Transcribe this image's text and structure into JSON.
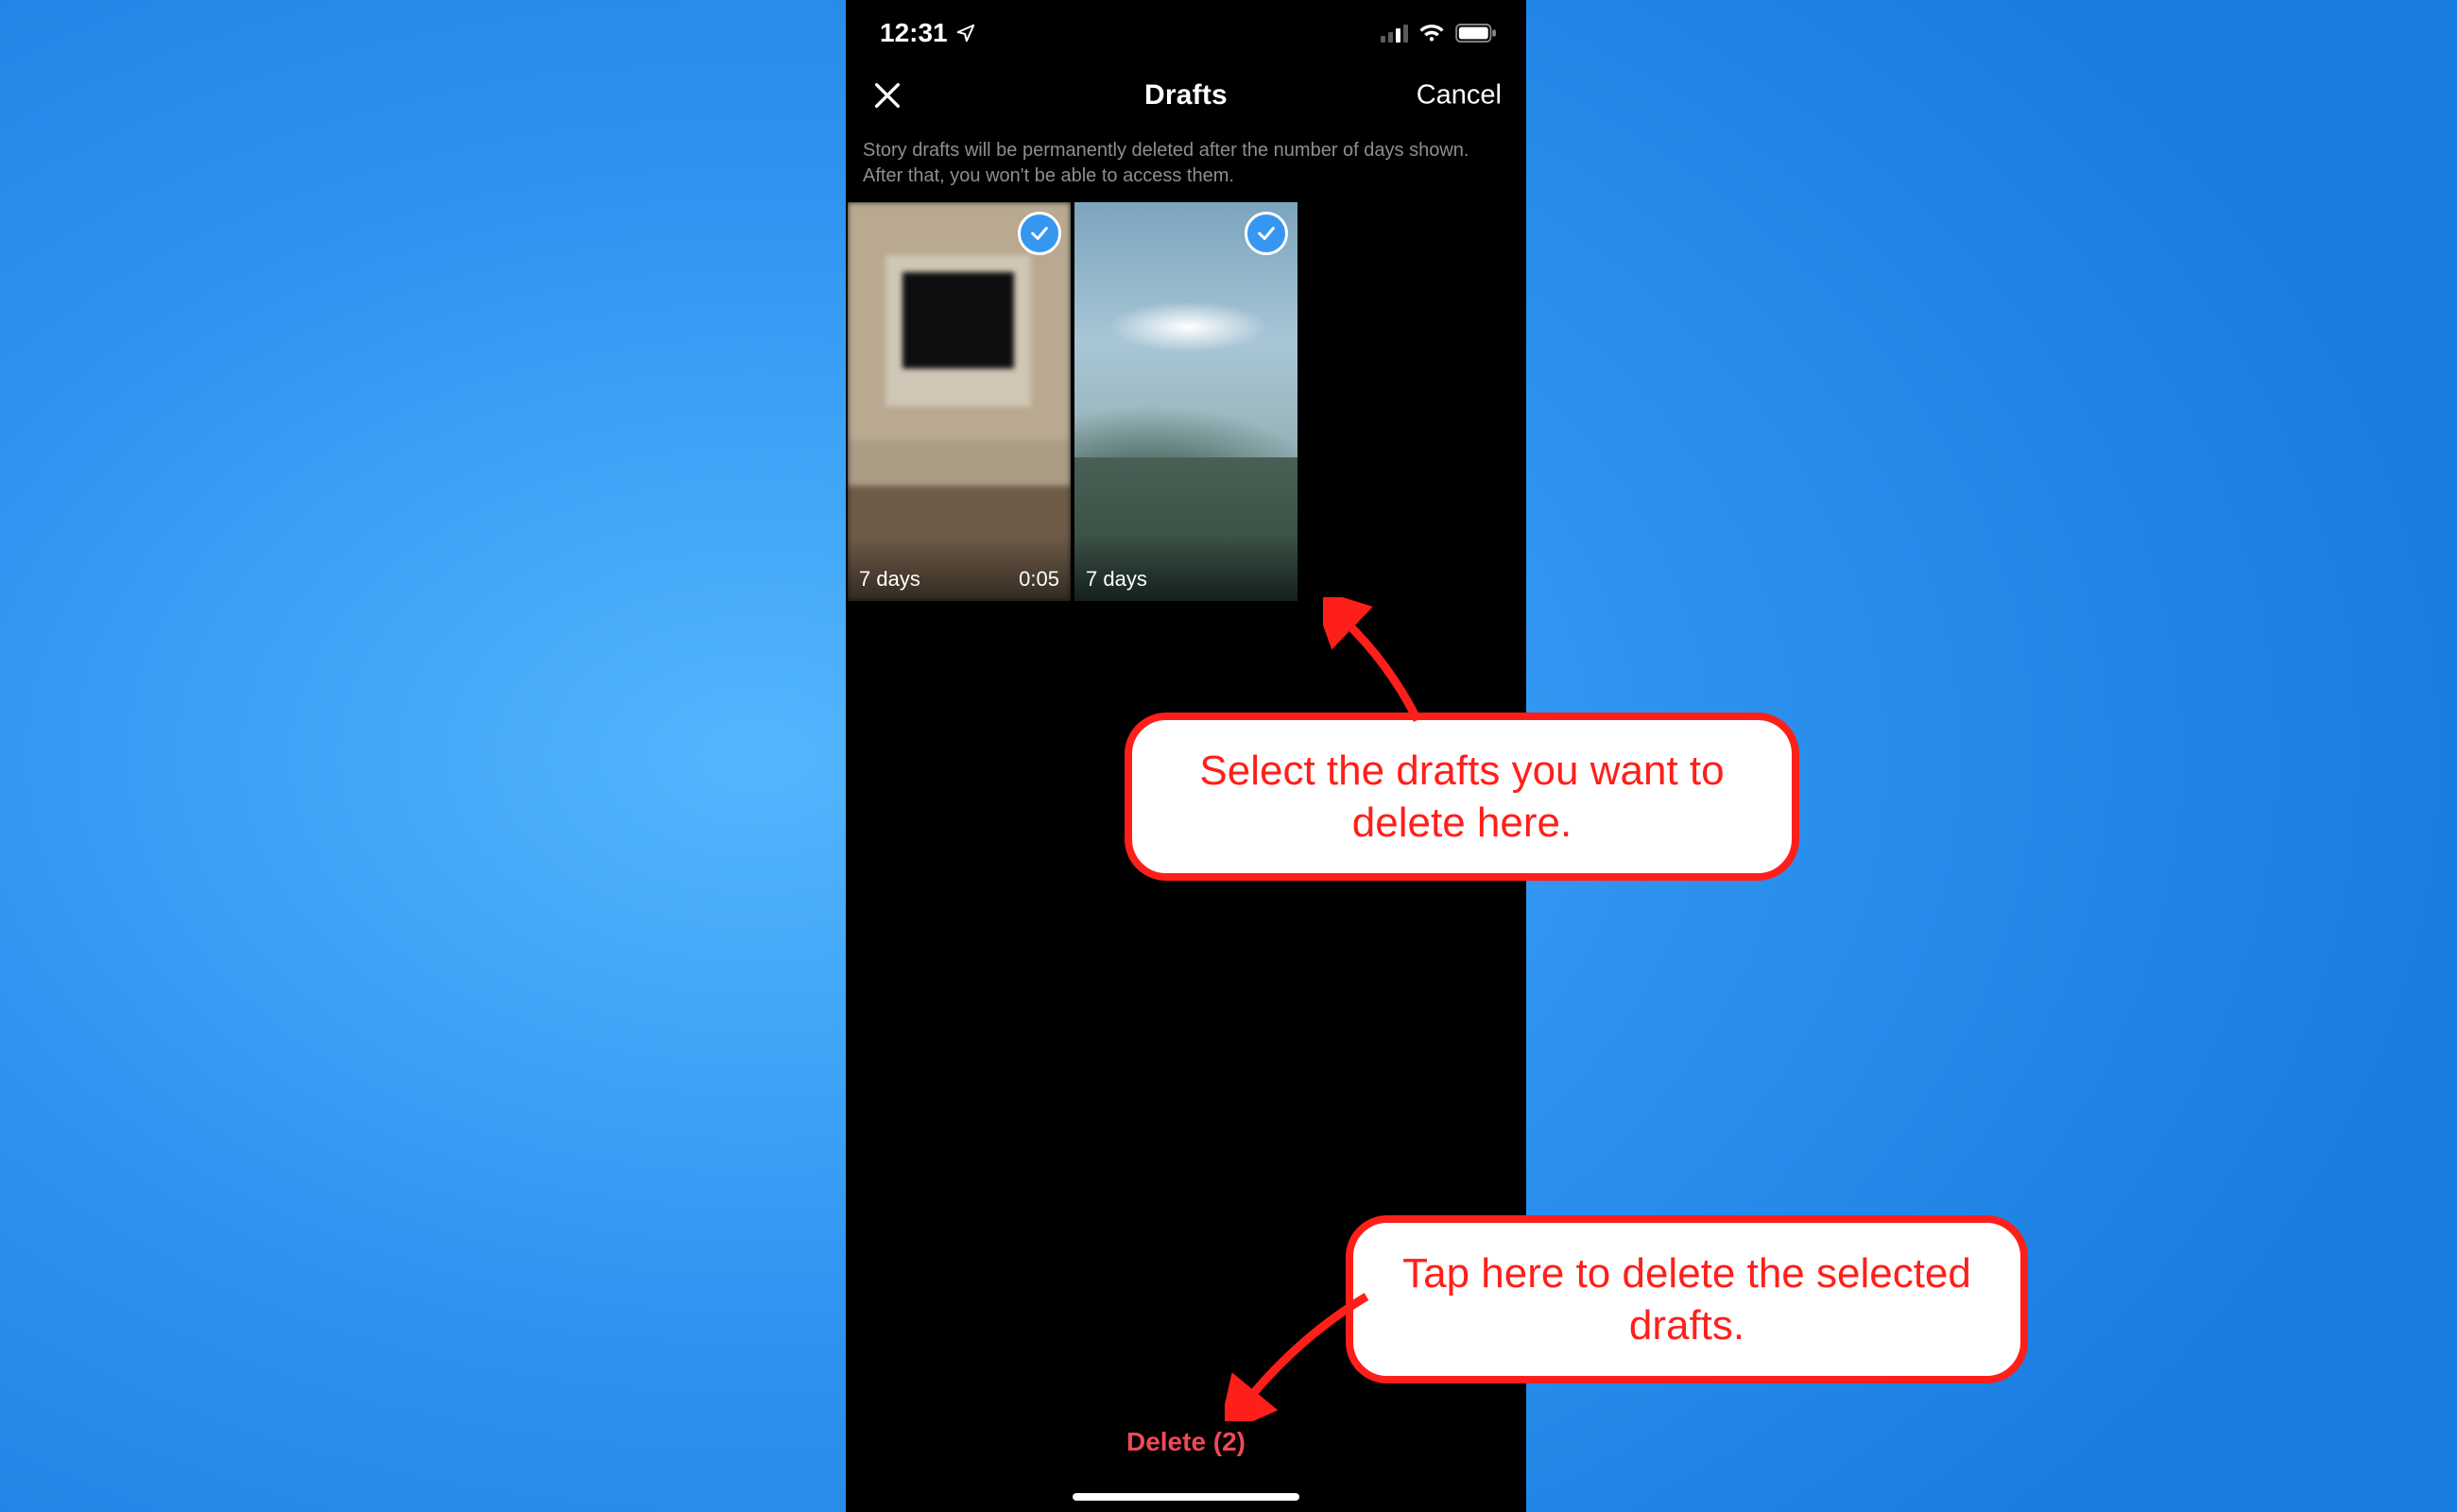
{
  "statusbar": {
    "time": "12:31"
  },
  "nav": {
    "title": "Drafts",
    "cancel": "Cancel"
  },
  "info_text": "Story drafts will be permanently deleted after the number of days shown. After that, you won't be able to access them.",
  "drafts": [
    {
      "expiry": "7 days",
      "duration": "0:05",
      "selected": true
    },
    {
      "expiry": "7 days",
      "duration": "",
      "selected": true
    }
  ],
  "delete_label": "Delete (2)",
  "annotations": {
    "callout1": "Select the drafts you want to delete here.",
    "callout2": "Tap here to delete the selected drafts."
  },
  "colors": {
    "accent_red": "#ff1f1a",
    "delete_red": "#ed4956",
    "select_blue": "#3797f0"
  }
}
